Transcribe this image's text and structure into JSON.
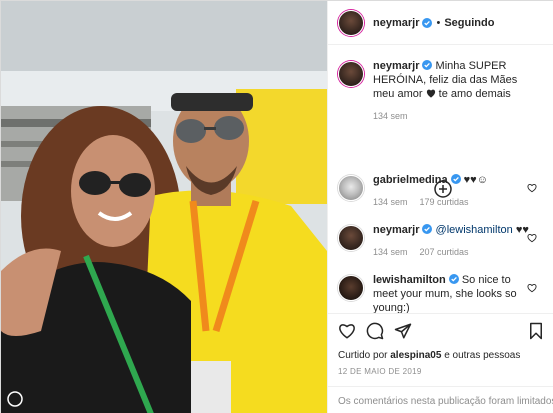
{
  "post": {
    "author": "neymarjr",
    "follow_status": "Seguindo",
    "separator": "•"
  },
  "caption": {
    "username": "neymarjr",
    "text": "Minha SUPER HERÓINA, feliz dia das Mães meu amor",
    "suffix": "te amo demais",
    "time": "134 sem"
  },
  "comments": [
    {
      "username": "gabrielmedina",
      "text": "♥♥☺",
      "time": "134 sem",
      "likes": "179 curtidas"
    },
    {
      "username": "neymarjr",
      "mention": "@lewishamilton",
      "text": "♥♥",
      "time": "134 sem",
      "likes": "207 curtidas"
    },
    {
      "username": "lewishamilton",
      "text": "So nice to meet your mum, she looks so young:)"
    }
  ],
  "liked_by": {
    "prefix": "Curtido por",
    "user": "alespina05",
    "suffix": "e outras pessoas"
  },
  "date": "12 DE MAIO DE 2019",
  "comments_limited": "Os comentários nesta publicação foram limitados.",
  "colors": {
    "verified": "#3897f0",
    "shirt": "#f5dc1f",
    "lanyard": "#f08a1c",
    "secondary_text": "#8e8e8e"
  },
  "icons": [
    "heart-icon",
    "comment-icon",
    "share-icon",
    "bookmark-icon",
    "plus-circle-icon",
    "verified-icon"
  ]
}
